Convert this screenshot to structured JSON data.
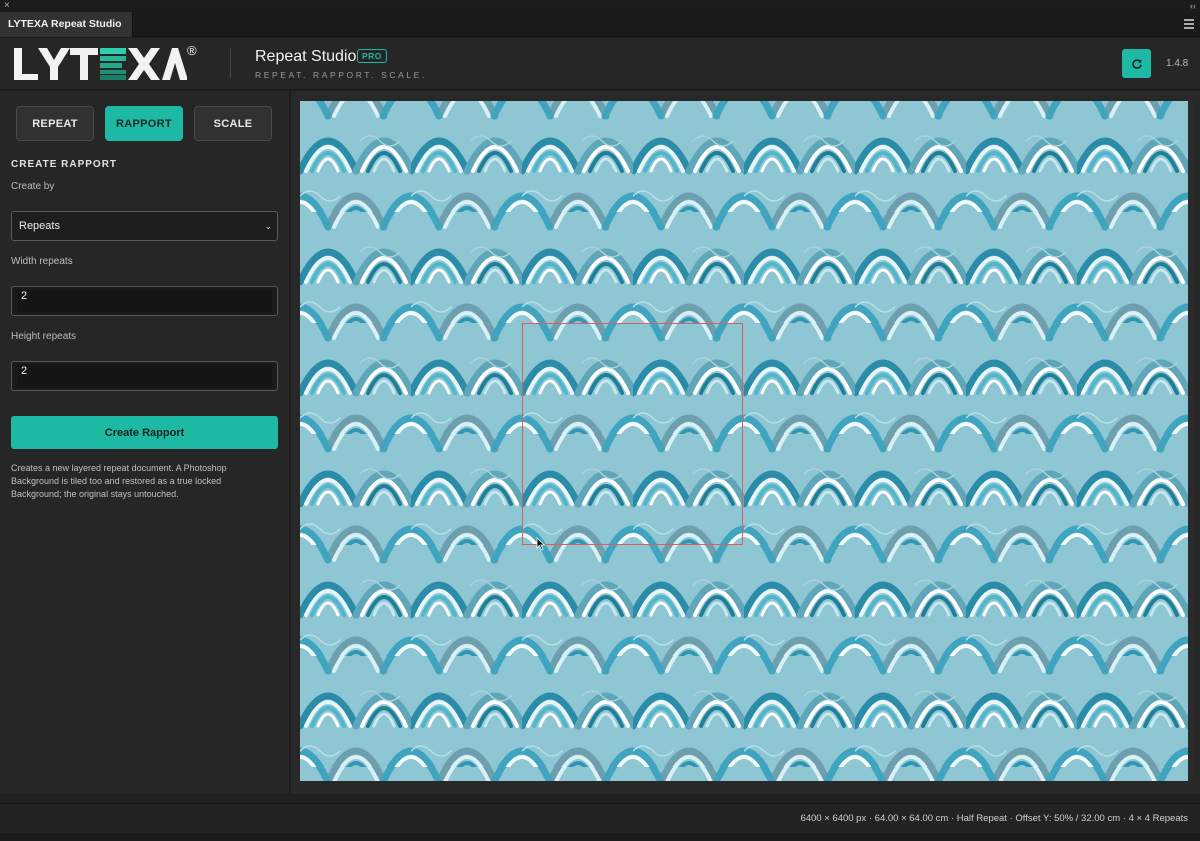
{
  "window": {
    "tab_title": "LYTEXA Repeat Studio Pro",
    "close_glyph": "×",
    "collapse_glyph": "‹‹"
  },
  "header": {
    "logo_text": "LYTEXA",
    "logo_mark": "®",
    "title": "Repeat Studio",
    "badge": "PRO",
    "tagline": "REPEAT. RAPPORT. SCALE.",
    "version": "1.4.8",
    "refresh_icon": "refresh-icon"
  },
  "modes": {
    "repeat": "REPEAT",
    "rapport": "RAPPORT",
    "scale": "SCALE",
    "active": "RAPPORT"
  },
  "form": {
    "section_title": "CREATE RAPPORT",
    "create_by_label": "Create by",
    "create_by_value": "Repeats",
    "chevron": "⌄",
    "width_label": "Width repeats",
    "width_value": "2",
    "height_label": "Height repeats",
    "height_value": "2",
    "create_button": "Create Rapport",
    "help": "Creates a new layered repeat document. A Photoshop Background is tiled too and restored as a true locked Background; the original stays untouched."
  },
  "status": {
    "text": "6400 × 6400 px · 64.00 × 64.00 cm · Half Repeat · Offset Y: 50% / 32.00 cm · 4 × 4 Repeats"
  },
  "colors": {
    "accent": "#1db9a4",
    "rapport_outline": "#d9605f",
    "panel": "#262626"
  }
}
